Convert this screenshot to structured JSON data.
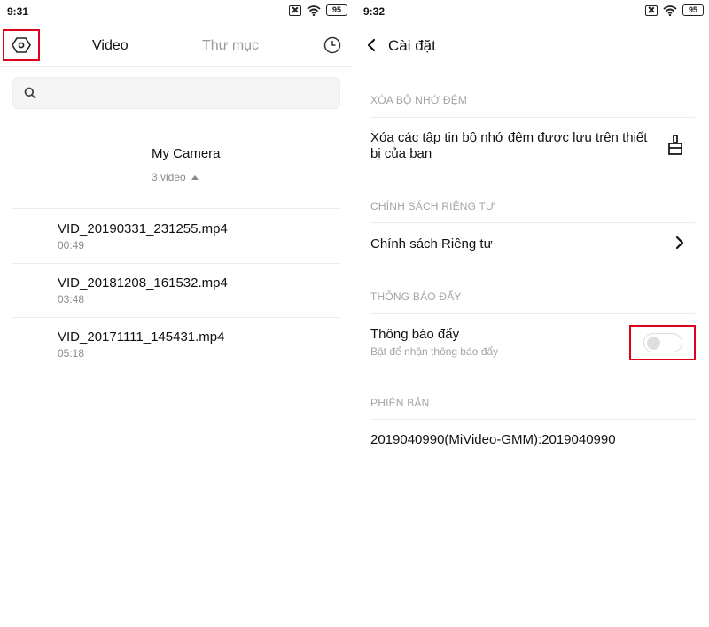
{
  "left": {
    "status": {
      "time": "9:31",
      "battery": "95"
    },
    "tabs": {
      "video": "Video",
      "folder": "Thư mục"
    },
    "folder": {
      "title": "My Camera",
      "count": "3 video"
    },
    "videos": [
      {
        "name": "VID_20190331_231255.mp4",
        "duration": "00:49"
      },
      {
        "name": "VID_20181208_161532.mp4",
        "duration": "03:48"
      },
      {
        "name": "VID_20171111_145431.mp4",
        "duration": "05:18"
      }
    ]
  },
  "right": {
    "status": {
      "time": "9:32",
      "battery": "95"
    },
    "title": "Cài đặt",
    "sections": {
      "cache_header": "XÓA BỘ NHỚ ĐỆM",
      "cache_line1": "Xóa các tập tin bộ nhớ đệm được lưu trên thiết",
      "cache_line2": "bị của bạn",
      "privacy_header": "CHÍNH SÁCH RIÊNG TƯ",
      "privacy_item": "Chính sách Riêng tư",
      "push_header": "THÔNG BÁO ĐẨY",
      "push_title": "Thông báo đẩy",
      "push_subtitle": "Bật để nhận thông báo đẩy",
      "push_enabled": false,
      "version_header": "PHIÊN BẢN",
      "version_value": "2019040990(MiVideo-GMM):2019040990"
    }
  },
  "colors": {
    "highlight": "#e0001b",
    "muted": "#a3a3a3"
  }
}
